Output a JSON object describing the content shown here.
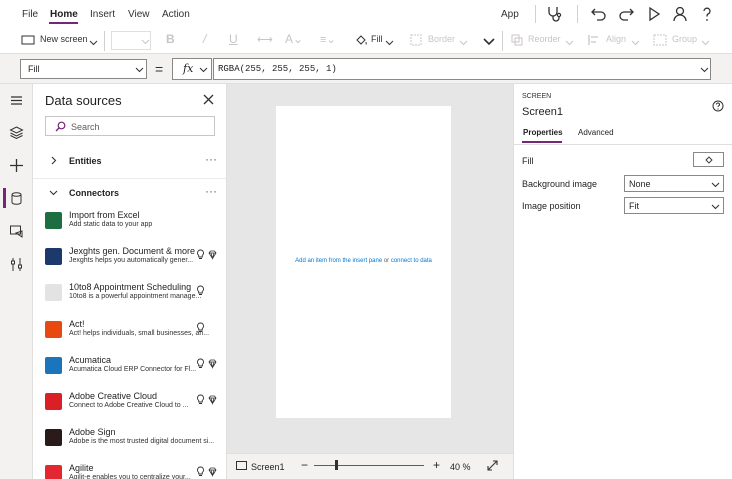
{
  "menu": {
    "items": [
      "File",
      "Home",
      "Insert",
      "View",
      "Action"
    ],
    "active": "Home",
    "app_label": "App"
  },
  "ribbon": {
    "new_screen": "New screen",
    "fill": "Fill",
    "border": "Border",
    "reorder": "Reorder",
    "align": "Align",
    "group": "Group"
  },
  "formula": {
    "property": "Fill",
    "equals": "=",
    "fx": "fx",
    "value": "RGBA(255, 255, 255, 1)"
  },
  "data_sources": {
    "title": "Data sources",
    "search_placeholder": "Search",
    "sections": [
      {
        "label": "Entities"
      },
      {
        "label": "Connectors"
      }
    ],
    "connectors": [
      {
        "name": "Import from Excel",
        "desc": "Add static data to your app",
        "color": "#1d6f42",
        "icons": []
      },
      {
        "name": "Jexghts gen. Document & more",
        "desc": "Jexghts helps you automatically gener...",
        "color": "#1b3a6b",
        "icons": [
          "bulb-icon",
          "premium-diamond-icon"
        ]
      },
      {
        "name": "10to8 Appointment Scheduling",
        "desc": "10to8 is a powerful appointment manage...",
        "color": "#e3e3e3",
        "icons": [
          "bulb-icon"
        ]
      },
      {
        "name": "Act!",
        "desc": "Act! helps individuals, small businesses, an...",
        "color": "#e8490f",
        "icons": [
          "bulb-icon"
        ]
      },
      {
        "name": "Acumatica",
        "desc": "Acumatica Cloud ERP Connector for Fl...",
        "color": "#1b75bc",
        "icons": [
          "bulb-icon",
          "premium-diamond-icon"
        ]
      },
      {
        "name": "Adobe Creative Cloud",
        "desc": "Connect to Adobe Creative Cloud to ...",
        "color": "#da1f26",
        "icons": [
          "bulb-icon",
          "premium-diamond-icon"
        ]
      },
      {
        "name": "Adobe Sign",
        "desc": "Adobe is the most trusted digital document si...",
        "color": "#2b1a1a",
        "icons": []
      },
      {
        "name": "Agilite",
        "desc": "Agilit-e enables you to centralize your...",
        "color": "#e3262f",
        "icons": [
          "bulb-icon",
          "premium-diamond-icon"
        ]
      }
    ]
  },
  "canvas": {
    "hint_prefix": "Add an item from the insert pane",
    "hint_or": "or",
    "hint_link": "connect to data",
    "screen_name": "Screen1",
    "zoom": "40 %",
    "zoom_level": 40
  },
  "properties": {
    "kind": "SCREEN",
    "name": "Screen1",
    "tabs": [
      "Properties",
      "Advanced"
    ],
    "active_tab": "Properties",
    "fill_label": "Fill",
    "bg_image_label": "Background image",
    "bg_image_value": "None",
    "img_pos_label": "Image position",
    "img_pos_value": "Fit"
  },
  "colors": {
    "accent": "#742774",
    "link": "#0078d4"
  }
}
